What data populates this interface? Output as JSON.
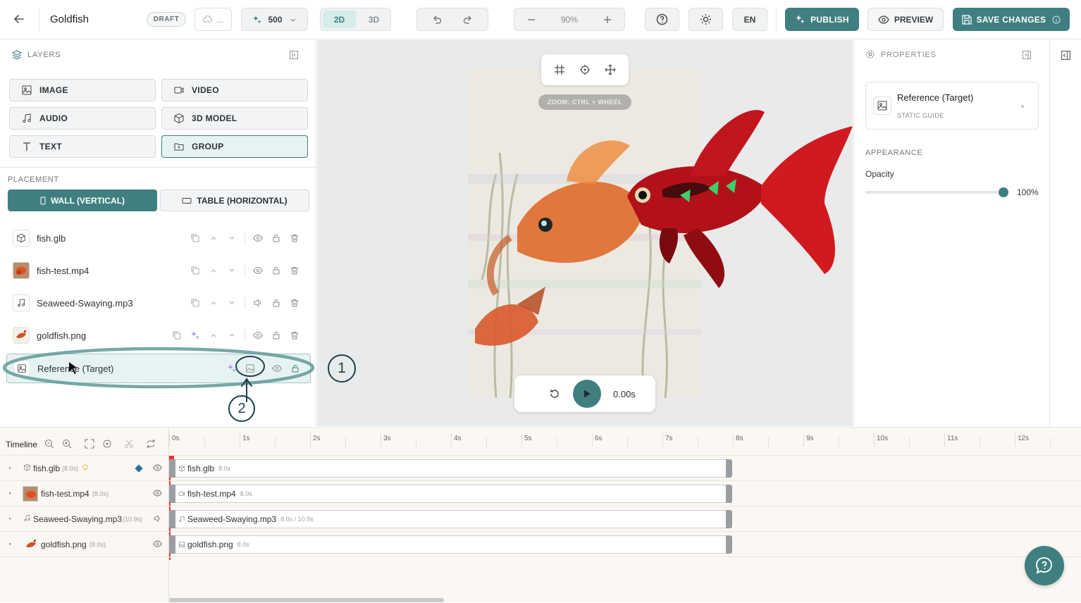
{
  "header": {
    "title": "Goldfish",
    "status_badge": "DRAFT",
    "cloud_label": "...",
    "credits_value": "500",
    "view_2d": "2D",
    "view_3d": "3D",
    "zoom_value": "90%",
    "lang": "EN",
    "publish_label": "PUBLISH",
    "preview_label": "PREVIEW",
    "save_label": "SAVE CHANGES"
  },
  "layers_panel": {
    "title": "LAYERS",
    "add_buttons": [
      "IMAGE",
      "VIDEO",
      "AUDIO",
      "3D MODEL",
      "TEXT",
      "GROUP"
    ],
    "placement_label": "PLACEMENT",
    "placement_wall": "WALL (VERTICAL)",
    "placement_table": "TABLE (HORIZONTAL)",
    "items": [
      {
        "name": "fish.glb",
        "icon": "cube-icon"
      },
      {
        "name": "fish-test.mp4",
        "icon": "video-thumbnail"
      },
      {
        "name": "Seaweed-Swaying.mp3",
        "icon": "music-icon"
      },
      {
        "name": "goldfish.png",
        "icon": "image-thumbnail"
      },
      {
        "name": "Reference (Target)",
        "icon": "image-icon",
        "selected": true
      }
    ]
  },
  "annotations": {
    "marker_1": "1",
    "marker_2": "2"
  },
  "canvas": {
    "zoom_hint": "ZOOM: CTRL + WHEEL",
    "time": "0.00s"
  },
  "properties": {
    "title": "PROPERTIES",
    "item_name": "Reference (Target)",
    "item_type": "STATIC GUIDE",
    "section": "APPEARANCE",
    "opacity_label": "Opacity",
    "opacity_value": "100%",
    "opacity": 1.0
  },
  "timeline": {
    "title": "Timeline",
    "ticks": [
      "0s",
      "1s",
      "2s",
      "3s",
      "4s",
      "5s",
      "6s",
      "7s",
      "8s",
      "9s",
      "10s",
      "11s",
      "12s"
    ],
    "rows": [
      {
        "name": "fish.glb",
        "duration": "(8.0s)",
        "track_label": "fish.glb",
        "track_meta": "8.0s"
      },
      {
        "name": "fish-test.mp4",
        "duration": "(8.0s)",
        "track_label": "fish-test.mp4",
        "track_meta": "8.0s"
      },
      {
        "name": "Seaweed-Swaying.mp3",
        "duration": "(10.9s)",
        "track_label": "Seaweed-Swaying.mp3",
        "track_meta": "8.0s / 10.9s"
      },
      {
        "name": "goldfish.png",
        "duration": "(8.0s)",
        "track_label": "goldfish.png",
        "track_meta": "8.0s"
      }
    ]
  },
  "colors": {
    "accent": "#3f7f80",
    "annotation": "#1f3f4f",
    "playhead": "#e53935"
  }
}
